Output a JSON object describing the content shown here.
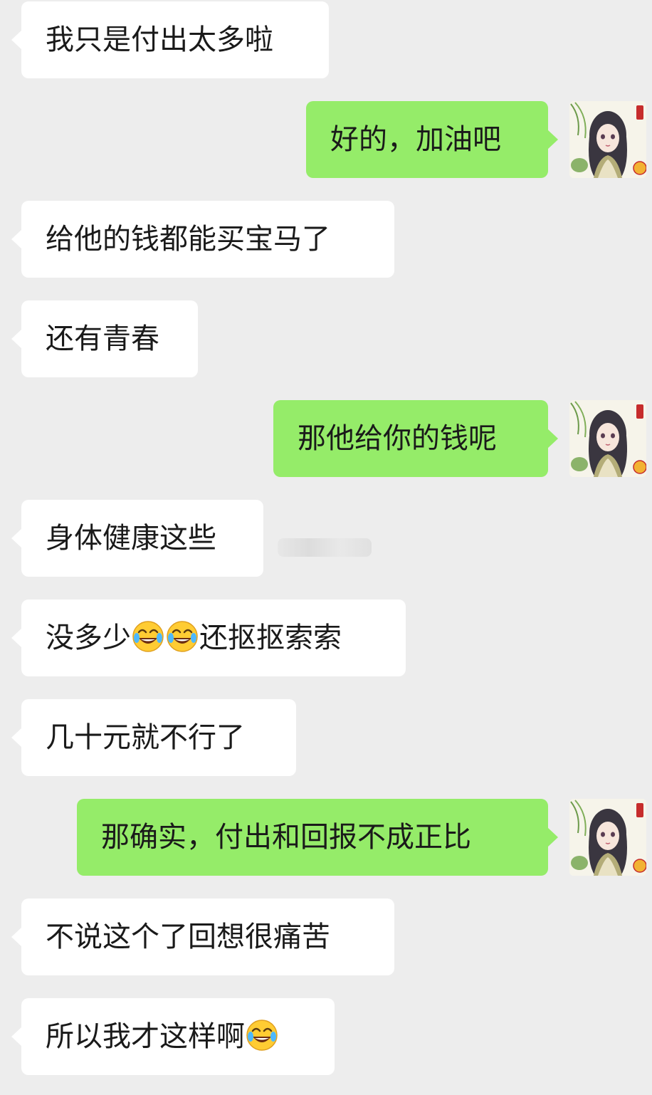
{
  "colors": {
    "background": "#ededed",
    "incoming_bubble": "#ffffff",
    "outgoing_bubble": "#95ec69",
    "text": "#1a1a1a"
  },
  "messages": [
    {
      "side": "in",
      "segments": [
        {
          "t": "我只是付出太多啦"
        }
      ]
    },
    {
      "side": "out",
      "segments": [
        {
          "t": "好的，加油吧"
        }
      ]
    },
    {
      "side": "in",
      "segments": [
        {
          "t": "给他的钱都能买宝马了"
        }
      ]
    },
    {
      "side": "in",
      "segments": [
        {
          "t": "还有青春"
        }
      ]
    },
    {
      "side": "out",
      "segments": [
        {
          "t": "那他给你的钱呢"
        }
      ]
    },
    {
      "side": "in",
      "segments": [
        {
          "t": "身体健康这些"
        }
      ]
    },
    {
      "side": "in",
      "segments": [
        {
          "t": "没多少"
        },
        {
          "emoji": "tears-of-joy-emoji"
        },
        {
          "emoji": "tears-of-joy-emoji"
        },
        {
          "t": "还抠抠索索"
        }
      ]
    },
    {
      "side": "in",
      "segments": [
        {
          "t": "几十元就不行了"
        }
      ]
    },
    {
      "side": "out",
      "segments": [
        {
          "t": "那确实，付出和回报不成正比"
        }
      ]
    },
    {
      "side": "in",
      "segments": [
        {
          "t": "不说这个了回想很痛苦"
        }
      ]
    },
    {
      "side": "in",
      "segments": [
        {
          "t": "所以我才这样啊"
        },
        {
          "emoji": "tears-of-joy-emoji"
        }
      ]
    }
  ],
  "avatar_icon": "woman-illustration-avatar"
}
